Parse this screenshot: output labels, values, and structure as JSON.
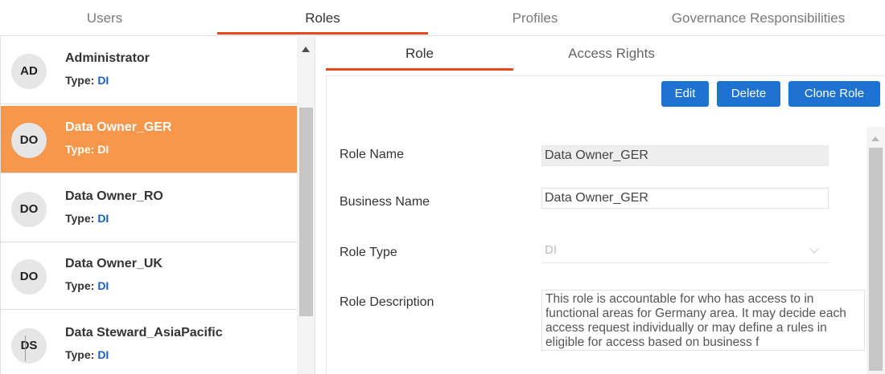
{
  "top_tabs": [
    {
      "label": "Users"
    },
    {
      "label": "Roles"
    },
    {
      "label": "Profiles"
    },
    {
      "label": "Governance Responsibilities"
    }
  ],
  "type_label": "Type:",
  "roles": [
    {
      "initials": "AD",
      "name": "Administrator",
      "type": "DI"
    },
    {
      "initials": "DO",
      "name": "Data Owner_GER",
      "type": "DI"
    },
    {
      "initials": "DO",
      "name": "Data Owner_RO",
      "type": "DI"
    },
    {
      "initials": "DO",
      "name": "Data Owner_UK",
      "type": "DI"
    },
    {
      "initials": "DS",
      "name": "Data Steward_AsiaPacific",
      "type": "DI"
    }
  ],
  "sub_tabs": [
    {
      "label": "Role"
    },
    {
      "label": "Access Rights"
    }
  ],
  "actions": {
    "edit": "Edit",
    "delete": "Delete",
    "clone": "Clone Role"
  },
  "form": {
    "role_name_label": "Role Name",
    "role_name_value": "Data Owner_GER",
    "business_name_label": "Business Name",
    "business_name_value": "Data Owner_GER",
    "role_type_label": "Role Type",
    "role_type_value": "DI",
    "role_description_label": "Role Description",
    "role_description_value": "This role is accountable for who has access to in functional areas for Germany area. It may decide each access request individually or may define a rules in eligible for access based on business f"
  },
  "colors": {
    "accent": "#e8481c",
    "selected_row": "#f7974b",
    "button": "#1d72d2"
  }
}
